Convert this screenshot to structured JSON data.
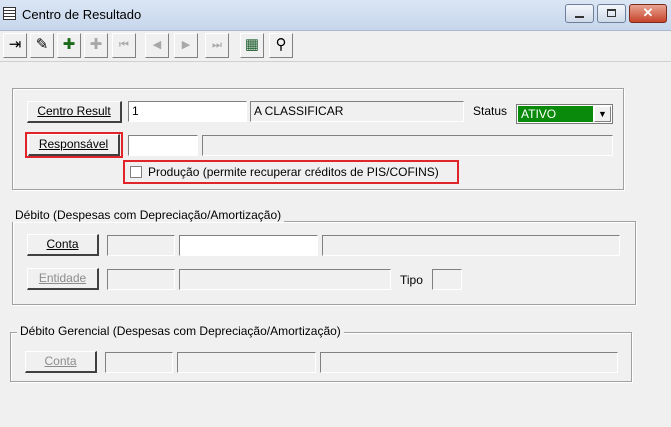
{
  "window": {
    "title": "Centro de Resultado",
    "close_glyph": "✕"
  },
  "toolbar": {
    "buttons": [
      {
        "icon": "exit-icon",
        "glyph": "⇥",
        "enabled": true
      },
      {
        "icon": "eraser-icon",
        "glyph": "✎",
        "enabled": true
      },
      {
        "icon": "add-icon",
        "glyph": "✚",
        "enabled": true
      },
      {
        "icon": "edit-icon",
        "glyph": "✚",
        "enabled": false
      },
      {
        "icon": "first-record-icon",
        "glyph": "⏮",
        "enabled": false
      },
      {
        "icon": "previous-record-icon",
        "glyph": "◀",
        "enabled": false
      },
      {
        "icon": "next-record-icon",
        "glyph": "▶",
        "enabled": false
      },
      {
        "icon": "last-record-icon",
        "glyph": "⏭",
        "enabled": false
      },
      {
        "icon": "grid-icon",
        "glyph": "▦",
        "enabled": true
      },
      {
        "icon": "binoculars-icon",
        "glyph": "⚲",
        "enabled": true
      }
    ]
  },
  "main": {
    "centro_result_label": "Centro Result",
    "centro_result_code": "1",
    "centro_result_desc": "A CLASSIFICAR",
    "status_label": "Status",
    "status_value": "ATIVO",
    "responsavel_label": "Responsável",
    "responsavel_code": "",
    "responsavel_name": "",
    "producao_label": "Produção (permite recuperar créditos de PIS/COFINS)",
    "producao_checked": false
  },
  "debito": {
    "legend": "Débito (Despesas com Depreciação/Amortização)",
    "conta_label": "Conta",
    "conta_code": "",
    "conta_number": "",
    "conta_desc": "",
    "entidade_label": "Entidade",
    "entidade_code": "",
    "entidade_desc": "",
    "tipo_label": "Tipo",
    "tipo_value": ""
  },
  "debito_gerencial": {
    "legend": "Débito Gerencial (Despesas com Depreciação/Amortização)",
    "conta_label": "Conta",
    "conta_code": "",
    "conta_number": "",
    "conta_desc": ""
  },
  "colors": {
    "status_active": "#0a8a0a",
    "highlight": "#e0242a"
  }
}
